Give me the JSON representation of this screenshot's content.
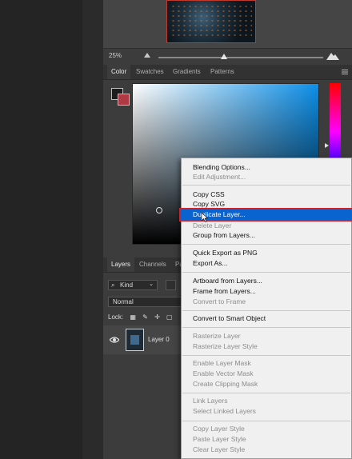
{
  "zoom": {
    "value": "25%"
  },
  "color_panel": {
    "tabs": [
      "Color",
      "Swatches",
      "Gradients",
      "Patterns"
    ],
    "foreground": "#1d1d1d",
    "background": "#b03a43"
  },
  "layers_panel": {
    "tabs": [
      "Layers",
      "Channels",
      "Pa"
    ],
    "kind_label": "Kind",
    "blend_mode": "Normal",
    "lock_label": "Lock:",
    "layer_name": "Layer 0"
  },
  "context_menu": {
    "items": [
      {
        "label": "Blending Options...",
        "disabled": false
      },
      {
        "label": "Edit Adjustment...",
        "disabled": true
      },
      {
        "label": "Copy CSS",
        "disabled": false
      },
      {
        "label": "Copy SVG",
        "disabled": false
      },
      {
        "label": "Duplicate Layer...",
        "disabled": false,
        "highlighted": true
      },
      {
        "label": "Delete Layer",
        "disabled": true
      },
      {
        "label": "Group from Layers...",
        "disabled": false
      },
      {
        "label": "Quick Export as PNG",
        "disabled": false
      },
      {
        "label": "Export As...",
        "disabled": false
      },
      {
        "label": "Artboard from Layers...",
        "disabled": false
      },
      {
        "label": "Frame from Layers...",
        "disabled": false
      },
      {
        "label": "Convert to Frame",
        "disabled": true
      },
      {
        "label": "Convert to Smart Object",
        "disabled": false
      },
      {
        "label": "Rasterize Layer",
        "disabled": true
      },
      {
        "label": "Rasterize Layer Style",
        "disabled": true
      },
      {
        "label": "Enable Layer Mask",
        "disabled": true
      },
      {
        "label": "Enable Vector Mask",
        "disabled": true
      },
      {
        "label": "Create Clipping Mask",
        "disabled": true
      },
      {
        "label": "Link Layers",
        "disabled": true
      },
      {
        "label": "Select Linked Layers",
        "disabled": true
      },
      {
        "label": "Copy Layer Style",
        "disabled": true
      },
      {
        "label": "Paste Layer Style",
        "disabled": true
      },
      {
        "label": "Clear Layer Style",
        "disabled": true
      }
    ]
  }
}
